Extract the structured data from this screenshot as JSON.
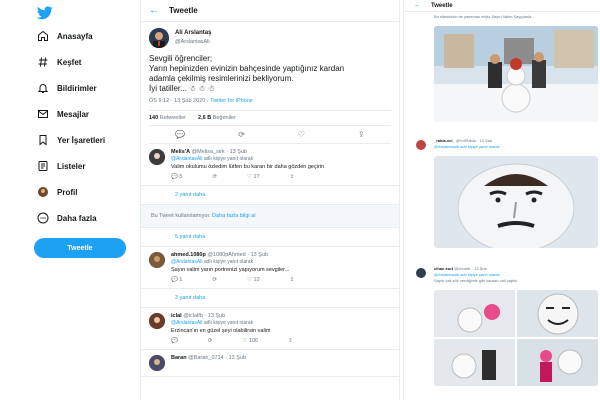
{
  "sidebar": {
    "items": [
      {
        "label": "Anasayfa",
        "icon": "home-icon"
      },
      {
        "label": "Keşfet",
        "icon": "hashtag-icon"
      },
      {
        "label": "Bildirimler",
        "icon": "bell-icon"
      },
      {
        "label": "Mesajlar",
        "icon": "mail-icon"
      },
      {
        "label": "Yer İşaretleri",
        "icon": "bookmark-icon"
      },
      {
        "label": "Listeler",
        "icon": "list-icon"
      },
      {
        "label": "Profil",
        "icon": "profile-icon"
      },
      {
        "label": "Daha fazla",
        "icon": "more-icon"
      }
    ],
    "tweet_button": "Tweetle"
  },
  "main": {
    "title": "Tweetle",
    "focal": {
      "name": "Ali Arslantaş",
      "handle": "@ArslantasAli",
      "text_lines": [
        "Sevgili öğrenciler;",
        "Yarın hepinizden evinizin bahçesinde yaptığınız kardan",
        "adamla çekilmiş resimlerinizi bekliyorum.",
        "İyi tatiller... ☃ ☃ ☃"
      ],
      "time": "ÖS 9:12 · 13 Şub 2020 ·",
      "source": "Twitter for iPhone",
      "retweets_count": "140",
      "retweets_label": "Retweetler",
      "likes_count": "2,6 B",
      "likes_label": "Beğeniler"
    },
    "replies": [
      {
        "name": "Melis'A",
        "handle": "@Melisa_sirk",
        "time": "· 13 Şub",
        "reply_to_handle": "@ArslantasAli",
        "reply_to_suffix": "adlı kişiye yanıt olarak",
        "text": "Valim okulumu özledim lütfen bu kararı bir daha gözden geçirin",
        "replies": "5",
        "likes": "17"
      },
      {
        "name": "ahmed.1080p",
        "handle": "@1080pAhmed",
        "time": "· 13 Şub",
        "reply_to_handle": "@ArslantasAli",
        "reply_to_suffix": "adlı kişiye yanıt olarak",
        "text": "Sayın valim yarın portrenizi yapıyorum sevgiler...",
        "replies": "1",
        "likes": "12"
      },
      {
        "name": "iclal",
        "handle": "@iclalfb",
        "time": "· 13 Şub",
        "reply_to_handle": "@ArslantasAli",
        "reply_to_suffix": "adlı kişiye yanıt olarak",
        "text": "Erzincan'ın en güzel şeyi olabilirsin valim",
        "replies": "",
        "likes": "106"
      },
      {
        "name": "Baran",
        "handle": "@Baran_0714",
        "time": "· 13 Şub",
        "reply_to_handle": "",
        "reply_to_suffix": "",
        "text": "",
        "replies": "",
        "likes": ""
      }
    ],
    "more_replies_1": "2 yanıt daha",
    "unavailable_text": "Bu Tweet kullanılamıyor.",
    "unavailable_link": "Daha fazla bilgi al",
    "more_replies_2": "5 yanıt daha",
    "more_replies_3": "3 yanıt daha"
  },
  "right": {
    "title": "Tweetle",
    "caption": "Bu sitesinizin de yasemaz miyiz Sayın Valim Saygılarla...",
    "reply1": {
      "name": "_rabia.vcl_",
      "handle": "@VclRabia",
      "time": "· 13 Şub",
      "reply_to": "@ArslantasAli adlı kişiye yanıt olarak"
    },
    "reply2": {
      "name": "cihan kurt",
      "handle": "@chnetfr",
      "time": "· 13 Şub",
      "reply_to": "@ArslantasAli adlı kişiye yanıt olarak",
      "text": "Sayın vali söz verdiğimiz gibi kardan vali yaptık"
    }
  },
  "colors": {
    "accent": "#1da1f2",
    "muted": "#657786",
    "border": "#e6ecf0"
  }
}
